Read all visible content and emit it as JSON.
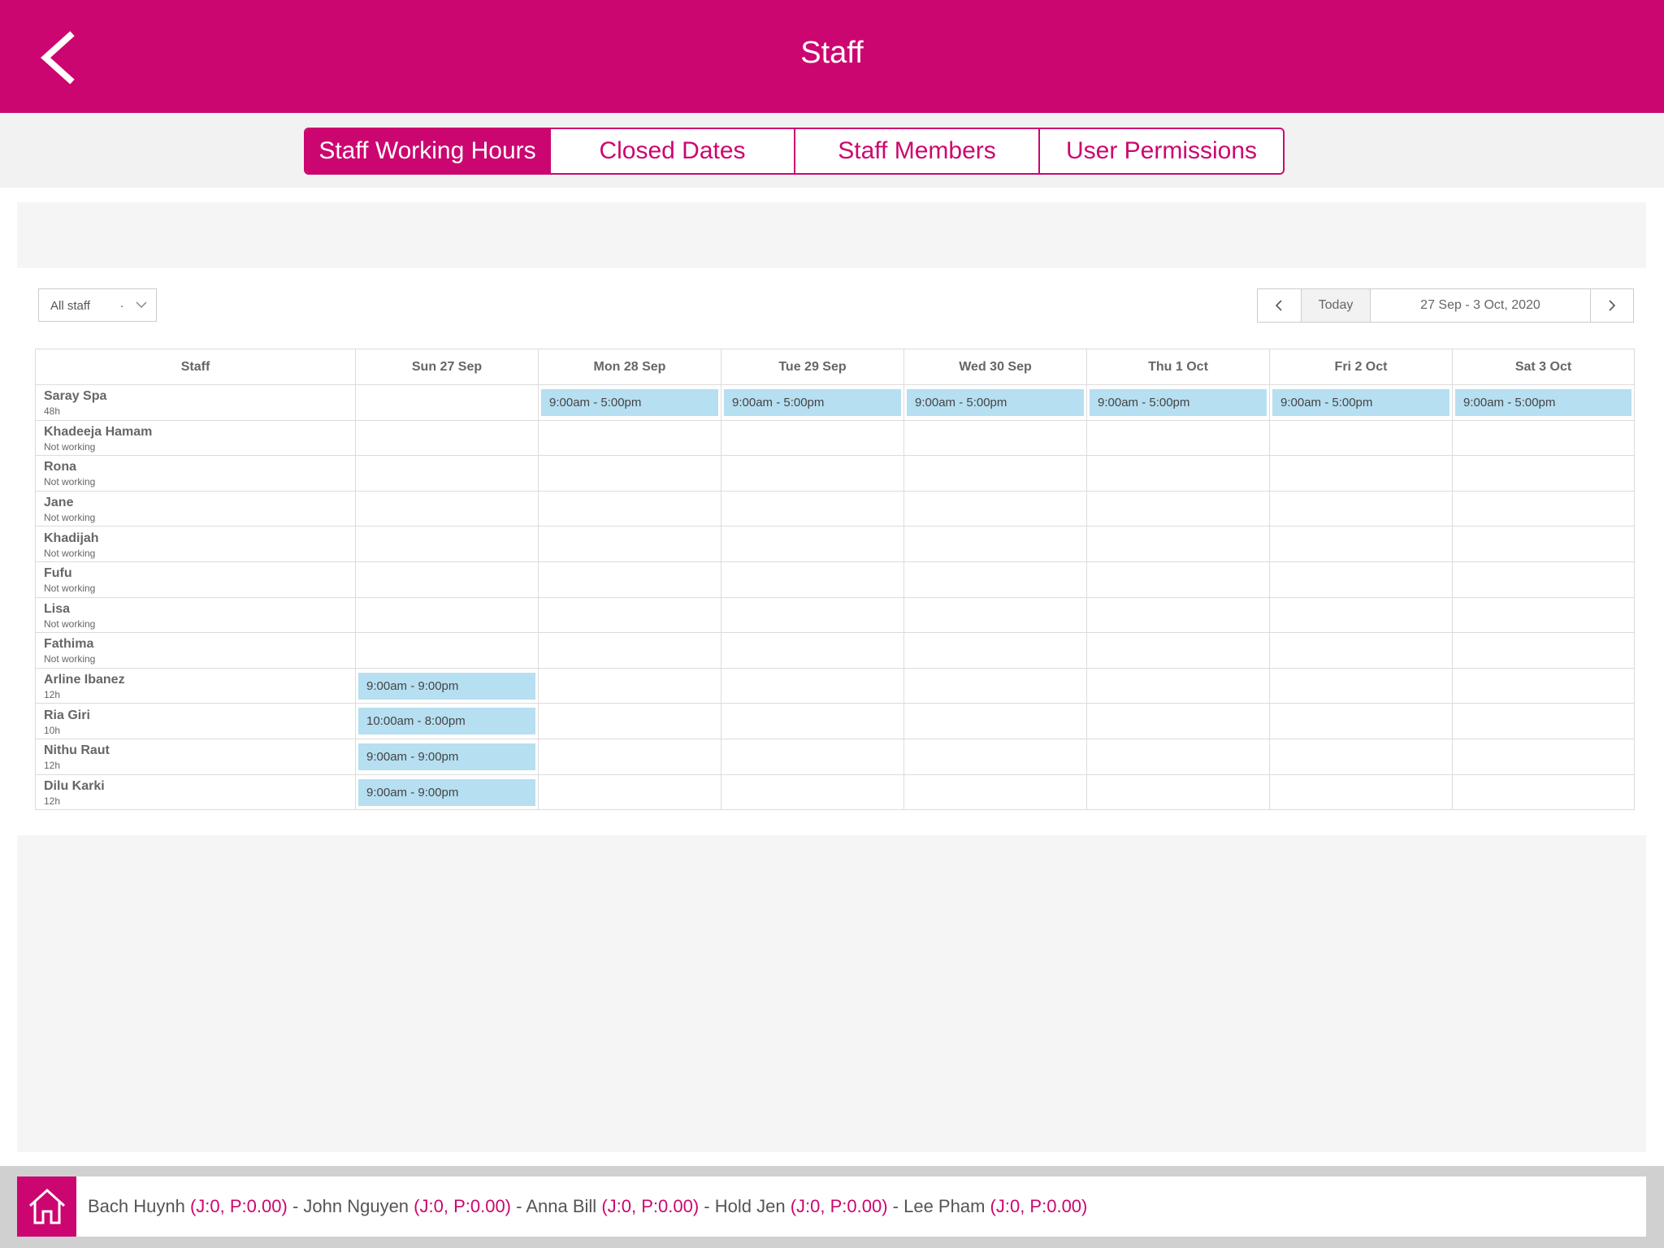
{
  "header": {
    "title": "Staff"
  },
  "tabs": [
    {
      "label": "Staff Working Hours",
      "active": true
    },
    {
      "label": "Closed Dates",
      "active": false
    },
    {
      "label": "Staff Members",
      "active": false
    },
    {
      "label": "User Permissions",
      "active": false
    }
  ],
  "filter": {
    "value": "All staff",
    "dot": "."
  },
  "date_nav": {
    "today_label": "Today",
    "range": "27 Sep - 3 Oct, 2020"
  },
  "table": {
    "staff_header": "Staff",
    "days": [
      "Sun 27 Sep",
      "Mon 28 Sep",
      "Tue 29 Sep",
      "Wed 30 Sep",
      "Thu 1 Oct",
      "Fri 2 Oct",
      "Sat 3 Oct"
    ],
    "rows": [
      {
        "name": "Saray Spa",
        "sub": "48h",
        "shifts": [
          "",
          "9:00am - 5:00pm",
          "9:00am - 5:00pm",
          "9:00am - 5:00pm",
          "9:00am - 5:00pm",
          "9:00am - 5:00pm",
          "9:00am - 5:00pm"
        ]
      },
      {
        "name": "Khadeeja Hamam",
        "sub": "Not working",
        "shifts": [
          "",
          "",
          "",
          "",
          "",
          "",
          ""
        ]
      },
      {
        "name": "Rona",
        "sub": "Not working",
        "shifts": [
          "",
          "",
          "",
          "",
          "",
          "",
          ""
        ]
      },
      {
        "name": "Jane",
        "sub": "Not working",
        "shifts": [
          "",
          "",
          "",
          "",
          "",
          "",
          ""
        ]
      },
      {
        "name": "Khadijah",
        "sub": "Not working",
        "shifts": [
          "",
          "",
          "",
          "",
          "",
          "",
          ""
        ]
      },
      {
        "name": "Fufu",
        "sub": "Not working",
        "shifts": [
          "",
          "",
          "",
          "",
          "",
          "",
          ""
        ]
      },
      {
        "name": "Lisa",
        "sub": "Not working",
        "shifts": [
          "",
          "",
          "",
          "",
          "",
          "",
          ""
        ]
      },
      {
        "name": "Fathima",
        "sub": "Not working",
        "shifts": [
          "",
          "",
          "",
          "",
          "",
          "",
          ""
        ]
      },
      {
        "name": "Arline Ibanez",
        "sub": "12h",
        "shifts": [
          "9:00am - 9:00pm",
          "",
          "",
          "",
          "",
          "",
          ""
        ]
      },
      {
        "name": "Ria Giri",
        "sub": "10h",
        "shifts": [
          "10:00am - 8:00pm",
          "",
          "",
          "",
          "",
          "",
          ""
        ]
      },
      {
        "name": "Nithu Raut",
        "sub": "12h",
        "shifts": [
          "9:00am - 9:00pm",
          "",
          "",
          "",
          "",
          "",
          ""
        ]
      },
      {
        "name": "Dilu Karki",
        "sub": "12h",
        "shifts": [
          "9:00am - 9:00pm",
          "",
          "",
          "",
          "",
          "",
          ""
        ]
      }
    ]
  },
  "footer": {
    "users": [
      {
        "name": "Bach Huynh",
        "meta": "(J:0, P:0.00)"
      },
      {
        "name": "John Nguyen",
        "meta": "(J:0, P:0.00)"
      },
      {
        "name": "Anna Bill",
        "meta": "(J:0, P:0.00)"
      },
      {
        "name": "Hold Jen",
        "meta": "(J:0, P:0.00)"
      },
      {
        "name": "Lee Pham",
        "meta": "(J:0, P:0.00)"
      }
    ],
    "separator": " - "
  },
  "colors": {
    "brand": "#cc0670",
    "shift": "#b6dff1"
  },
  "icons": {
    "back": "chevron-left-icon",
    "home": "home-icon",
    "prev": "chevron-left-icon",
    "next": "chevron-right-icon",
    "dropdown": "chevron-down-icon"
  }
}
